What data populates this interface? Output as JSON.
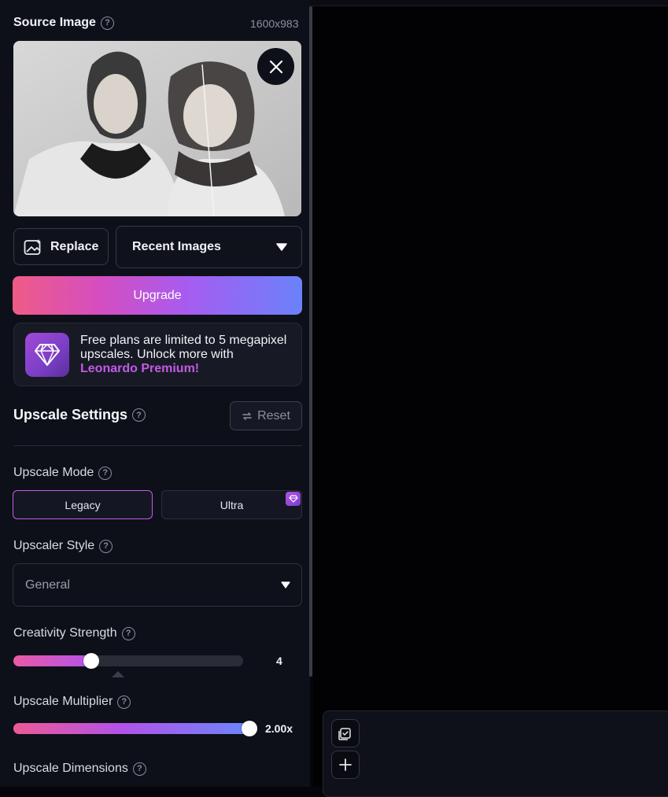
{
  "source": {
    "title": "Source Image",
    "dimensions": "1600x983",
    "replace_label": "Replace",
    "recent_label": "Recent Images"
  },
  "upgrade": {
    "button_label": "Upgrade",
    "promo_text": "Free plans are limited to 5 megapixel upscales. Unlock more with ",
    "promo_link": "Leonardo Premium!"
  },
  "settings": {
    "title": "Upscale Settings",
    "reset_label": "Reset",
    "mode": {
      "label": "Upscale Mode",
      "options": [
        "Legacy",
        "Ultra"
      ],
      "selected": "Legacy"
    },
    "style": {
      "label": "Upscaler Style",
      "value": "General"
    },
    "creativity": {
      "label": "Creativity Strength",
      "value": "4",
      "fraction": 0.34
    },
    "multiplier": {
      "label": "Upscale Multiplier",
      "value": "2.00x",
      "fraction": 1.0
    },
    "dimensions": {
      "label": "Upscale Dimensions"
    }
  },
  "colors": {
    "panel": "#0e1019",
    "accent": "#c45ae8",
    "gradient_start": "#ef5b86",
    "gradient_end": "#6a82fb"
  },
  "icons": [
    "help-icon",
    "close-icon",
    "image-replace-icon",
    "caret-down-icon",
    "diamond-icon",
    "reset-icon",
    "select-all-icon",
    "plus-icon"
  ]
}
